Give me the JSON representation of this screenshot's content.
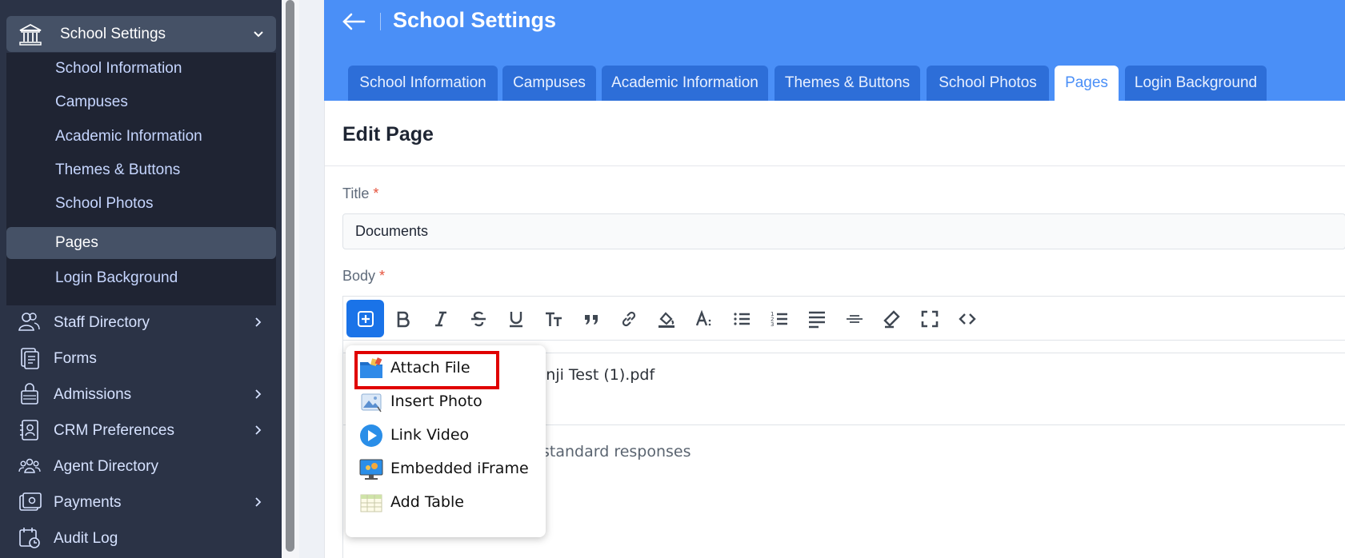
{
  "sidebar": {
    "section_label": "School Settings",
    "sub_items": [
      {
        "label": "School Information",
        "active": false
      },
      {
        "label": "Campuses",
        "active": false
      },
      {
        "label": "Academic Information",
        "active": false
      },
      {
        "label": "Themes & Buttons",
        "active": false
      },
      {
        "label": "School Photos",
        "active": false
      },
      {
        "label": "Pages",
        "active": true
      },
      {
        "label": "Login Background",
        "active": false
      }
    ],
    "items": [
      {
        "label": "Staff Directory",
        "icon": "people-icon",
        "has_chevron": true
      },
      {
        "label": "Forms",
        "icon": "forms-icon",
        "has_chevron": false
      },
      {
        "label": "Admissions",
        "icon": "admissions-icon",
        "has_chevron": true
      },
      {
        "label": "CRM Preferences",
        "icon": "contact-card-icon",
        "has_chevron": true
      },
      {
        "label": "Agent Directory",
        "icon": "group-icon",
        "has_chevron": false
      },
      {
        "label": "Payments",
        "icon": "wallet-icon",
        "has_chevron": true
      },
      {
        "label": "Audit Log",
        "icon": "calendar-clock-icon",
        "has_chevron": false
      }
    ]
  },
  "header": {
    "title": "School Settings",
    "tabs": [
      {
        "label": "School Information",
        "active": false
      },
      {
        "label": "Campuses",
        "active": false
      },
      {
        "label": "Academic Information",
        "active": false
      },
      {
        "label": "Themes & Buttons",
        "active": false
      },
      {
        "label": "School Photos",
        "active": false
      },
      {
        "label": "Pages",
        "active": true
      },
      {
        "label": "Login Background",
        "active": false
      }
    ]
  },
  "page": {
    "heading": "Edit Page",
    "title_label": "Title",
    "title_value": "Documents",
    "body_label": "Body",
    "required_mark": "*"
  },
  "editor": {
    "toolbar": [
      "insert-plus-icon",
      "bold-icon",
      "italic-icon",
      "strikethrough-icon",
      "underline-icon",
      "font-size-icon",
      "quote-icon",
      "link-icon",
      "fill-color-icon",
      "text-color-icon",
      "bullet-list-icon",
      "numbered-list-icon",
      "align-justify-icon",
      "horizontal-rule-icon",
      "clear-format-icon",
      "fullscreen-icon",
      "code-view-icon"
    ],
    "content_line1": "inji Test (1).pdf",
    "content_line2": "standard responses"
  },
  "insert_menu": {
    "items": [
      {
        "label": "Attach File",
        "icon": "folder-icon"
      },
      {
        "label": "Insert Photo",
        "icon": "photo-icon"
      },
      {
        "label": "Link Video",
        "icon": "play-icon"
      },
      {
        "label": "Embedded iFrame",
        "icon": "monitor-icon"
      },
      {
        "label": "Add Table",
        "icon": "table-icon"
      }
    ],
    "highlighted": "Attach File"
  },
  "colors": {
    "sidebar_bg": "#2b3346",
    "header_blue": "#4a8ff7",
    "tab_blue": "#2d6ed8",
    "highlight_red": "#e00000"
  }
}
